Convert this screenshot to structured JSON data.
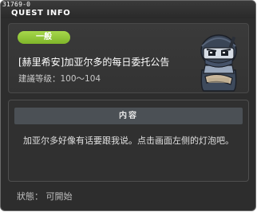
{
  "window": {
    "quest_id": "31769-0",
    "title": "QUEST INFO"
  },
  "quest": {
    "category": "一般",
    "title": "[赫里希安]加亚尔多的每日委托公告",
    "level_range": "建議等级：100～104"
  },
  "npc": {
    "icon": "ninja-npc-portrait"
  },
  "content": {
    "header": "内容",
    "body": "加亚尔多好像有话要跟我说。点击画面左侧的灯泡吧。"
  },
  "status": "狀態：  可開始",
  "colors": {
    "window_bg": "#2d2d2d",
    "badge_green": "#8fc43a",
    "section_header": "#4b5055"
  }
}
